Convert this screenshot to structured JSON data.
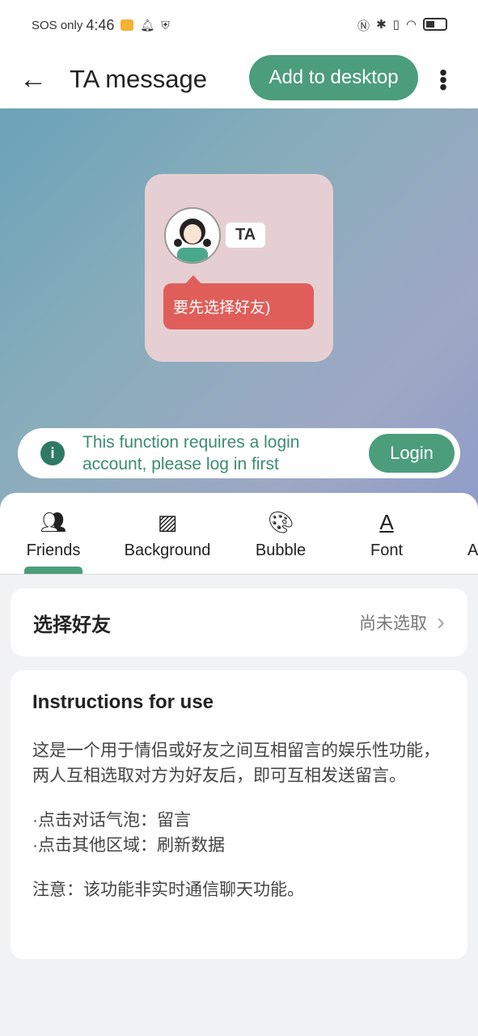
{
  "status": {
    "carrier": "SOS only",
    "time": "4:46"
  },
  "appbar": {
    "title": "TA message",
    "add_button": "Add to desktop"
  },
  "widget": {
    "name": "TA",
    "bubble_text": "要先选择好友)"
  },
  "login_banner": {
    "text_line1": "This function requires a login",
    "text_line2": "account, please log in first",
    "button": "Login"
  },
  "tabs": [
    {
      "label": "Friends",
      "icon": "friends-icon"
    },
    {
      "label": "Background",
      "icon": "background-icon"
    },
    {
      "label": "Bubble",
      "icon": "palette-icon"
    },
    {
      "label": "Font",
      "icon": "font-icon"
    },
    {
      "label": "A",
      "icon": ""
    }
  ],
  "select_friend": {
    "label": "选择好友",
    "value": "尚未选取"
  },
  "instructions": {
    "title": "Instructions for use",
    "p1": "这是一个用于情侣或好友之间互相留言的娱乐性功能，两人互相选取对方为好友后，即可互相发送留言。",
    "p2a": "·点击对话气泡：留言",
    "p2b": "·点击其他区域：刷新数据",
    "p3": "注意：该功能非实时通信聊天功能。"
  },
  "colors": {
    "accent": "#4b9d7c",
    "bubble": "#e05e59"
  }
}
